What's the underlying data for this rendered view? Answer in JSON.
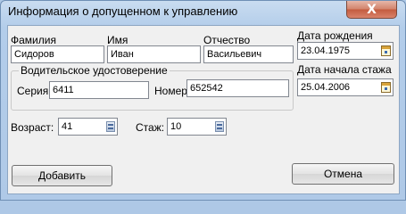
{
  "window": {
    "title": "Информация о допущенном к управлению",
    "close_glyph": "X"
  },
  "form": {
    "last_name_label": "Фамилия",
    "last_name_value": "Сидоров",
    "first_name_label": "Имя",
    "first_name_value": "Иван",
    "patronymic_label": "Отчество",
    "patronymic_value": "Васильевич",
    "birth_date_label": "Дата рождения",
    "birth_date_value": "23.04.1975",
    "license_group_label": "Водительское удостоверение",
    "series_label": "Серия",
    "series_value": "6411",
    "number_label": "Номер",
    "number_value": "652542",
    "experience_start_label": "Дата начала стажа",
    "experience_start_value": "25.04.2006",
    "age_label": "Возраст:",
    "age_value": "41",
    "experience_label": "Стаж:",
    "experience_value": "10"
  },
  "buttons": {
    "add_label": "Добавить",
    "cancel_label": "Отмена"
  },
  "icons": {
    "date_picker": "calendar-icon",
    "spinner": "spin-icon"
  }
}
